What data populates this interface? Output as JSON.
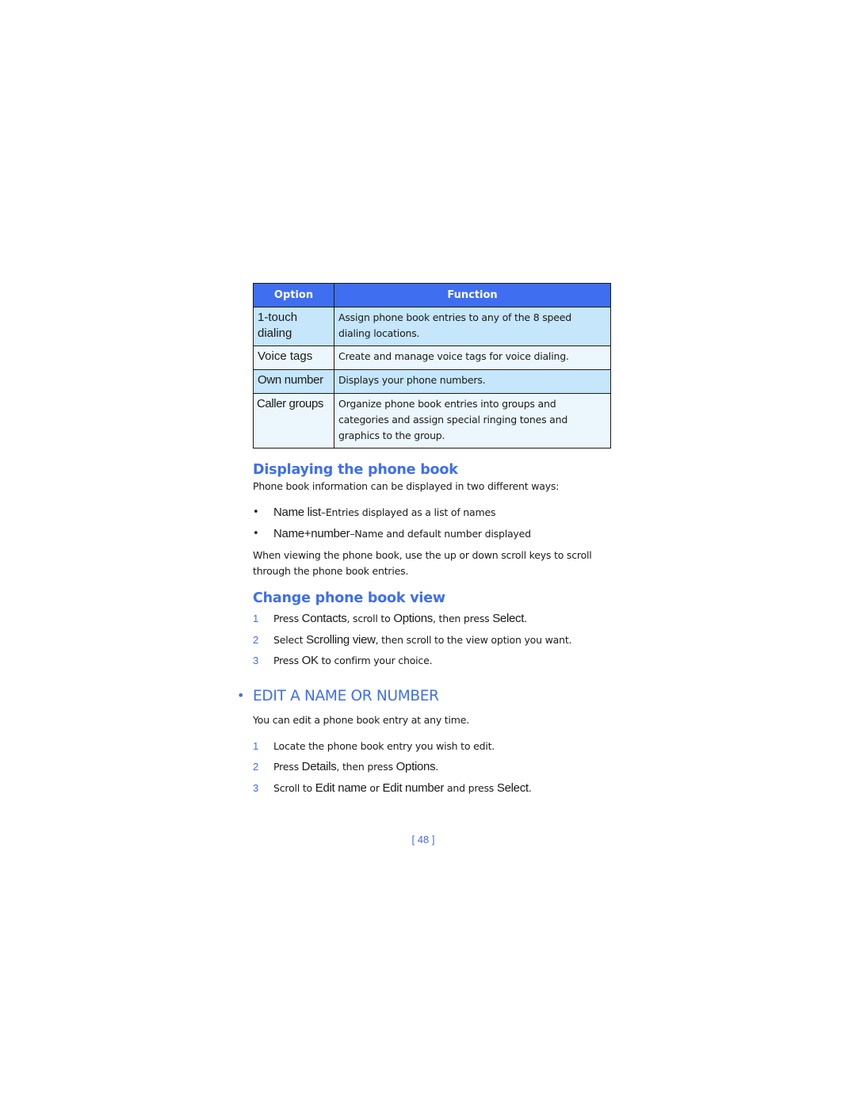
{
  "table": {
    "headers": {
      "option": "Option",
      "function": "Function"
    },
    "rows": [
      {
        "option": "1-touch dialing",
        "function": "Assign phone book entries to any of the 8 speed dialing locations."
      },
      {
        "option": "Voice tags",
        "function": "Create and manage voice tags for voice dialing."
      },
      {
        "option": "Own number",
        "function": "Displays your phone numbers."
      },
      {
        "option": "Caller groups",
        "function": "Organize phone book entries into groups and categories and assign special ringing tones and graphics to the group."
      }
    ]
  },
  "display_section": {
    "title": "Displaying the phone book",
    "intro": "Phone book information can be displayed in two different ways:",
    "bullets": [
      {
        "marker": "•",
        "keyword": "Name list",
        "text": "–Entries displayed as a list of names"
      },
      {
        "marker": "•",
        "keyword": "Name+number",
        "text": "–Name and default number displayed"
      }
    ],
    "note": "When viewing the phone book, use the up or down scroll keys to scroll through the phone book entries."
  },
  "change_section": {
    "title": "Change phone book view",
    "steps": [
      {
        "num": "1",
        "a": "Press ",
        "k1": "Contacts",
        "b": ", scroll to ",
        "k2": "Options",
        "c": ", then press ",
        "k3": "Select",
        "d": "."
      },
      {
        "num": "2",
        "a": "Select ",
        "k1": "Scrolling view",
        "b": ", then scroll to the view option you want.",
        "k2": "",
        "c": "",
        "k3": "",
        "d": ""
      },
      {
        "num": "3",
        "a": "Press ",
        "k1": "OK",
        "b": " to confirm your choice.",
        "k2": "",
        "c": "",
        "k3": "",
        "d": ""
      }
    ]
  },
  "edit_section": {
    "bullet": "•",
    "title": "EDIT A NAME OR NUMBER",
    "intro": "You can edit a phone book entry at any time.",
    "steps": [
      {
        "num": "1",
        "a": "Locate the phone book entry you wish to edit.",
        "k1": "",
        "b": "",
        "k2": "",
        "c": "",
        "k3": "",
        "d": ""
      },
      {
        "num": "2",
        "a": "Press ",
        "k1": "Details",
        "b": ", then press ",
        "k2": "Options",
        "c": ".",
        "k3": "",
        "d": ""
      },
      {
        "num": "3",
        "a": "Scroll to ",
        "k1": "Edit name",
        "b": " or ",
        "k2": "Edit number",
        "c": " and press ",
        "k3": "Select",
        "d": "."
      }
    ]
  },
  "page_number": "[ 48 ]",
  "colors": {
    "accent": "#3f6ef0",
    "row_alt": "#c5e6fb",
    "row_plain": "#ecf7fd"
  }
}
